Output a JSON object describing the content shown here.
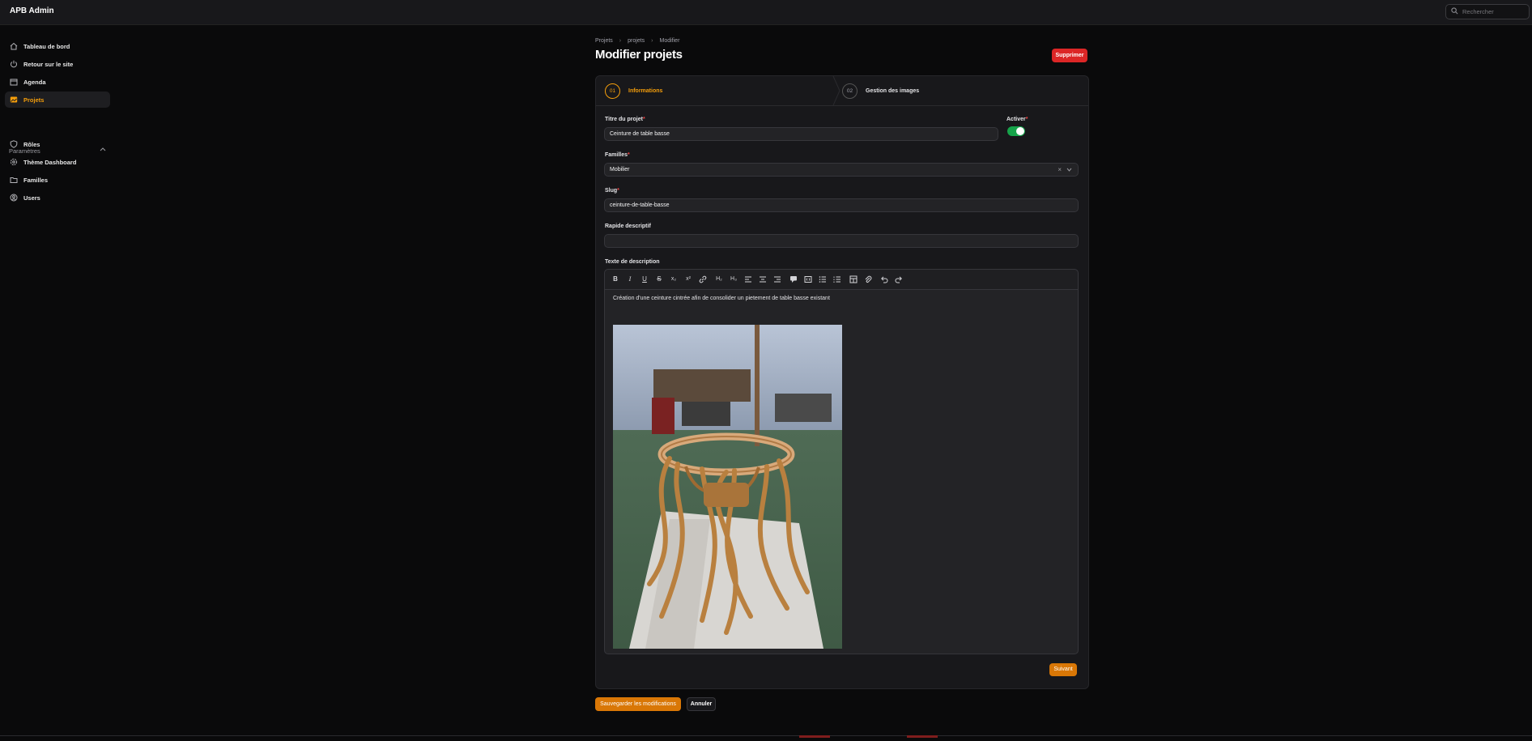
{
  "app": {
    "title": "APB Admin"
  },
  "search": {
    "placeholder": "Rechercher"
  },
  "sidebar": {
    "items": [
      {
        "label": "Tableau de bord",
        "icon": "home-icon"
      },
      {
        "label": "Retour sur le site",
        "icon": "power-icon"
      },
      {
        "label": "Agenda",
        "icon": "calendar-icon"
      },
      {
        "label": "Projets",
        "icon": "image-icon",
        "active": true
      }
    ],
    "group": {
      "label": "Paramètres",
      "expanded": true
    },
    "group_items": [
      {
        "label": "Rôles",
        "icon": "shield-icon"
      },
      {
        "label": "Thème Dashboard",
        "icon": "gear-icon"
      },
      {
        "label": "Familles",
        "icon": "folder-icon"
      },
      {
        "label": "Users",
        "icon": "user-circle-icon"
      }
    ]
  },
  "breadcrumb": [
    "Projets",
    "projets",
    "Modifier"
  ],
  "page": {
    "title": "Modifier projets",
    "delete_label": "Supprimer"
  },
  "steps": [
    {
      "number": "01",
      "label": "Informations",
      "active": true
    },
    {
      "number": "02",
      "label": "Gestion des images",
      "active": false
    }
  ],
  "form": {
    "title_label": "Titre du projet",
    "title_value": "Ceinture de table basse",
    "active_label": "Activer",
    "active_value": true,
    "family_label": "Familles",
    "family_value": "Mobilier",
    "slug_label": "Slug",
    "slug_value": "ceinture-de-table-basse",
    "short_label": "Rapide descriptif",
    "short_value": "",
    "desc_label": "Texte de description",
    "desc_text": "Création d'une ceinture cintrée afin de consolider un pietement de table basse existant"
  },
  "toolbar": [
    "bold-icon",
    "italic-icon",
    "underline-icon",
    "strike-icon",
    "subscript-icon",
    "superscript-icon",
    "link-icon",
    "h2-icon",
    "h3-icon",
    "align-left-icon",
    "align-center-icon",
    "align-right-icon",
    "quote-icon",
    "code-block-icon",
    "bullet-list-icon",
    "ordered-list-icon",
    "table-icon",
    "attach-icon",
    "undo-icon",
    "redo-icon"
  ],
  "buttons": {
    "next": "Suivant",
    "save": "Sauvegarder les modifications",
    "cancel": "Annuler"
  },
  "colors": {
    "accent": "#f59e0b",
    "danger": "#dc2626",
    "toggle_on": "#16a34a",
    "bg": "#0a0a0b",
    "panel": "#18181b"
  }
}
